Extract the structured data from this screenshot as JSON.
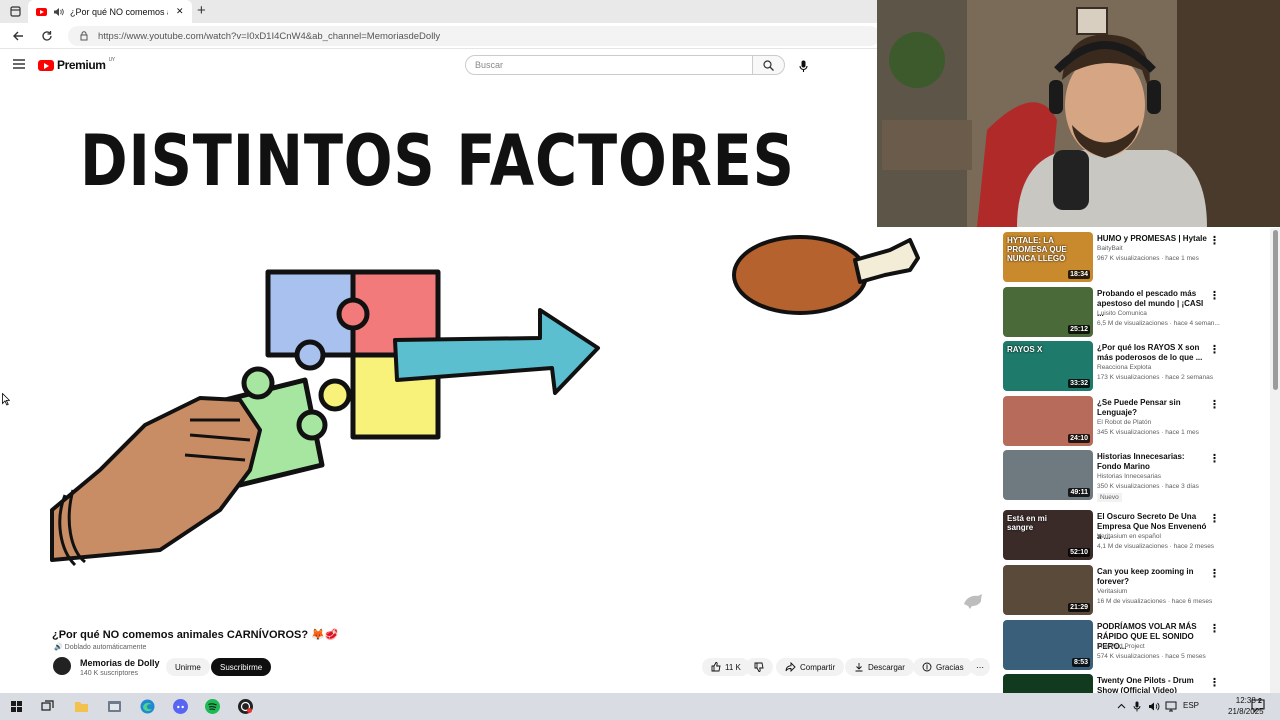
{
  "browser": {
    "tab_title": "¿Por qué NO comemos animales CARNÍVOROS? - YouTube",
    "new_tab_symbol": "+",
    "close_tab_symbol": "✕",
    "url": "https://www.youtube.com/watch?v=I0xD1I4CnW4&ab_channel=MemoriasdeDolly"
  },
  "youtube": {
    "logo_text": "Premium",
    "logo_region": "UY",
    "search_placeholder": "Buscar"
  },
  "video": {
    "heading": "DISTINTOS FACTORES",
    "title": "¿Por qué NO comemos animales CARNÍVOROS? 🦊🥩",
    "dubbed_label": "Doblado automáticamente",
    "channel_name": "Memorias de Dolly",
    "subscribers": "140 K suscriptores",
    "join_label": "Unirme",
    "subscribe_label": "Suscribirme",
    "likes": "11 K",
    "share_label": "Compartir",
    "download_label": "Descargar",
    "thanks_label": "Gracias",
    "more_symbol": "⋯"
  },
  "recommendations": [
    {
      "title": "HUMO y PROMESAS | Hytale",
      "channel": "BaityBait",
      "meta": "967 K visualizaciones · hace 1 mes",
      "duration": "18:34",
      "thumb_color": "#c98a2e",
      "thumb_text": "HYTALE: LA PROMESA QUE NUNCA LLEGÓ"
    },
    {
      "title": "Probando el pescado más apestoso del mundo | ¡CASI ...",
      "channel": "Luisito Comunica",
      "meta": "6,5 M de visualizaciones · hace 4 seman...",
      "duration": "25:12",
      "thumb_color": "#4a6a3a",
      "thumb_text": ""
    },
    {
      "title": "¿Por qué los RAYOS X son más poderosos de lo que ...",
      "channel": "Reacciona Explota",
      "meta": "173 K visualizaciones · hace 2 semanas",
      "duration": "33:32",
      "thumb_color": "#1e7a6a",
      "thumb_text": "RAYOS X"
    },
    {
      "title": "¿Se Puede Pensar sin Lenguaje?",
      "channel": "El Robot de Platón",
      "meta": "345 K visualizaciones · hace 1 mes",
      "duration": "24:10",
      "thumb_color": "#b76b5a",
      "thumb_text": ""
    },
    {
      "title": "Historias Innecesarias: Fondo Marino",
      "channel": "Historias Innecesarias",
      "meta": "350 K visualizaciones · hace 3 días",
      "duration": "49:11",
      "thumb_color": "#6f7a80",
      "thumb_text": "",
      "badge": "Nuevo"
    },
    {
      "title": "El Oscuro Secreto De Una Empresa Que Nos Envenenó a ...",
      "channel": "Veritasium en español",
      "meta": "4,1 M de visualizaciones · hace 2 meses",
      "duration": "52:10",
      "thumb_color": "#3a2b28",
      "thumb_text": "Está en mi sangre"
    },
    {
      "title": "Can you keep zooming in forever?",
      "channel": "Veritasium",
      "meta": "16 M de visualizaciones · hace 6 meses",
      "duration": "21:29",
      "thumb_color": "#5a4a3a",
      "thumb_text": ""
    },
    {
      "title": "PODRÍAMOS VOLAR MÁS RÁPIDO QUE EL SONIDO PERO...",
      "channel": "The Wild Project",
      "meta": "574 K visualizaciones · hace 5 meses",
      "duration": "8:53",
      "thumb_color": "#3a5f7a",
      "thumb_text": ""
    },
    {
      "title": "Twenty One Pilots - Drum Show (Official Video)",
      "channel": "",
      "meta": "",
      "duration": "",
      "thumb_color": "#123a1e",
      "thumb_text": ""
    }
  ],
  "taskbar": {
    "lang": "ESP",
    "time": "12:38",
    "date": "21/8/2025",
    "notifications": "2"
  },
  "colors": {
    "yt_red": "#ff0000",
    "subscribe_bg": "#0f0f0f",
    "taskbar_bg": "#d9dde3"
  }
}
